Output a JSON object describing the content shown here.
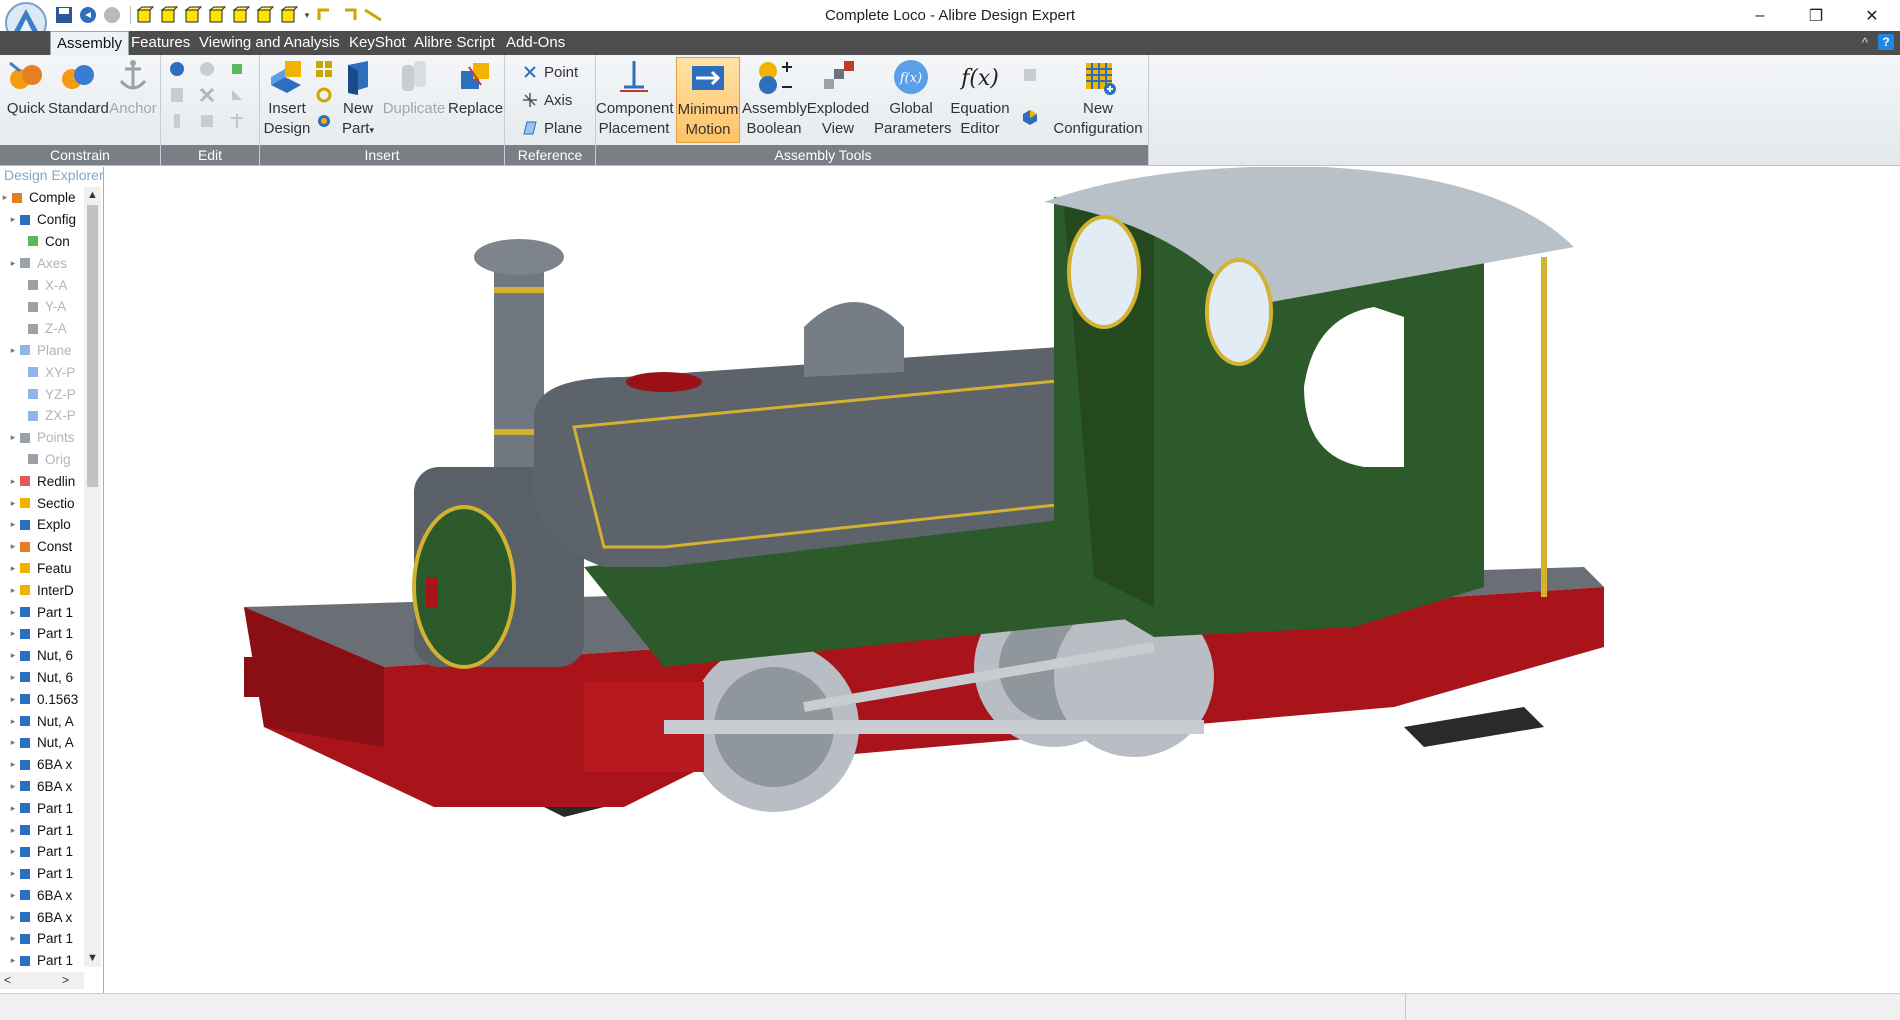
{
  "window": {
    "title": "Complete Loco - Alibre Design Expert",
    "minimize": "–",
    "restore": "❐",
    "close": "✕"
  },
  "menu": {
    "tabs": [
      "Assembly",
      "Features",
      "Viewing and Analysis",
      "KeyShot",
      "Alibre Script",
      "Add-Ons"
    ],
    "active": "Assembly",
    "collapse": "^",
    "help": "?"
  },
  "ribbon": {
    "constrain": {
      "label": "Constrain",
      "quick": "Quick",
      "standard": "Standard",
      "anchor": "Anchor"
    },
    "edit": {
      "label": "Edit"
    },
    "insert": {
      "label": "Insert",
      "insert_design_1": "Insert",
      "insert_design_2": "Design",
      "new_part_1": "New",
      "new_part_2": "Part",
      "duplicate": "Duplicate",
      "replace": "Replace"
    },
    "reference": {
      "label": "Reference",
      "point": "Point",
      "axis": "Axis",
      "plane": "Plane"
    },
    "assembly_tools": {
      "label": "Assembly Tools",
      "component_placement_1": "Component",
      "component_placement_2": "Placement",
      "minimum_motion_1": "Minimum",
      "minimum_motion_2": "Motion",
      "assembly_boolean_1": "Assembly",
      "assembly_boolean_2": "Boolean",
      "exploded_view_1": "Exploded",
      "exploded_view_2": "View",
      "global_parameters_1": "Global",
      "global_parameters_2": "Parameters",
      "equation_editor_1": "Equation",
      "equation_editor_2": "Editor",
      "new_configuration_1": "New",
      "new_configuration_2": "Configuration"
    }
  },
  "explorer": {
    "title": "Design Explorer",
    "items": [
      {
        "label": "Comple",
        "icon": "assembly-icon",
        "dim": false,
        "indent": 0
      },
      {
        "label": "Config",
        "icon": "config-icon",
        "dim": false,
        "indent": 1
      },
      {
        "label": "Con",
        "icon": "config-item-icon",
        "dim": false,
        "indent": 2
      },
      {
        "label": "Axes",
        "icon": "axes-icon",
        "dim": true,
        "indent": 1
      },
      {
        "label": "X-A",
        "icon": "axis-icon",
        "dim": true,
        "indent": 2
      },
      {
        "label": "Y-A",
        "icon": "axis-icon",
        "dim": true,
        "indent": 2
      },
      {
        "label": "Z-A",
        "icon": "axis-icon",
        "dim": true,
        "indent": 2
      },
      {
        "label": "Plane",
        "icon": "planes-icon",
        "dim": true,
        "indent": 1
      },
      {
        "label": "XY-P",
        "icon": "plane-icon",
        "dim": true,
        "indent": 2
      },
      {
        "label": "YZ-P",
        "icon": "plane-icon",
        "dim": true,
        "indent": 2
      },
      {
        "label": "ZX-P",
        "icon": "plane-icon",
        "dim": true,
        "indent": 2
      },
      {
        "label": "Points",
        "icon": "points-icon",
        "dim": true,
        "indent": 1
      },
      {
        "label": "Orig",
        "icon": "point-icon",
        "dim": true,
        "indent": 2
      },
      {
        "label": "Redlin",
        "icon": "redline-icon",
        "dim": false,
        "indent": 1
      },
      {
        "label": "Sectio",
        "icon": "section-icon",
        "dim": false,
        "indent": 1
      },
      {
        "label": "Explo",
        "icon": "explode-icon",
        "dim": false,
        "indent": 1
      },
      {
        "label": "Const",
        "icon": "constraint-icon",
        "dim": false,
        "indent": 1
      },
      {
        "label": "Featu",
        "icon": "feature-icon",
        "dim": false,
        "indent": 1
      },
      {
        "label": "InterD",
        "icon": "interdesign-icon",
        "dim": false,
        "indent": 1
      },
      {
        "label": "Part 1",
        "icon": "part-icon",
        "dim": false,
        "indent": 1
      },
      {
        "label": "Part 1",
        "icon": "part-icon",
        "dim": false,
        "indent": 1
      },
      {
        "label": "Nut, 6",
        "icon": "part-icon",
        "dim": false,
        "indent": 1
      },
      {
        "label": "Nut, 6",
        "icon": "part-icon",
        "dim": false,
        "indent": 1
      },
      {
        "label": "0.1563",
        "icon": "part-icon",
        "dim": false,
        "indent": 1
      },
      {
        "label": "Nut, A",
        "icon": "part-icon",
        "dim": false,
        "indent": 1
      },
      {
        "label": "Nut, A",
        "icon": "part-icon",
        "dim": false,
        "indent": 1
      },
      {
        "label": "6BA x",
        "icon": "part-icon",
        "dim": false,
        "indent": 1
      },
      {
        "label": "6BA x",
        "icon": "part-icon",
        "dim": false,
        "indent": 1
      },
      {
        "label": "Part 1",
        "icon": "part-icon",
        "dim": false,
        "indent": 1
      },
      {
        "label": "Part 1",
        "icon": "part-icon",
        "dim": false,
        "indent": 1
      },
      {
        "label": "Part 1",
        "icon": "part-icon",
        "dim": false,
        "indent": 1
      },
      {
        "label": "Part 1",
        "icon": "part-icon",
        "dim": false,
        "indent": 1
      },
      {
        "label": "6BA x",
        "icon": "part-icon",
        "dim": false,
        "indent": 1
      },
      {
        "label": "6BA x",
        "icon": "part-icon",
        "dim": false,
        "indent": 1
      },
      {
        "label": "Part 1",
        "icon": "part-icon",
        "dim": false,
        "indent": 1
      },
      {
        "label": "Part 1",
        "icon": "part-icon",
        "dim": false,
        "indent": 1
      }
    ]
  },
  "colors": {
    "boiler": "#5a6068",
    "green": "#2d5a2a",
    "red": "#a8141a",
    "brass": "#d2b230",
    "roof": "#b8c0c8"
  }
}
